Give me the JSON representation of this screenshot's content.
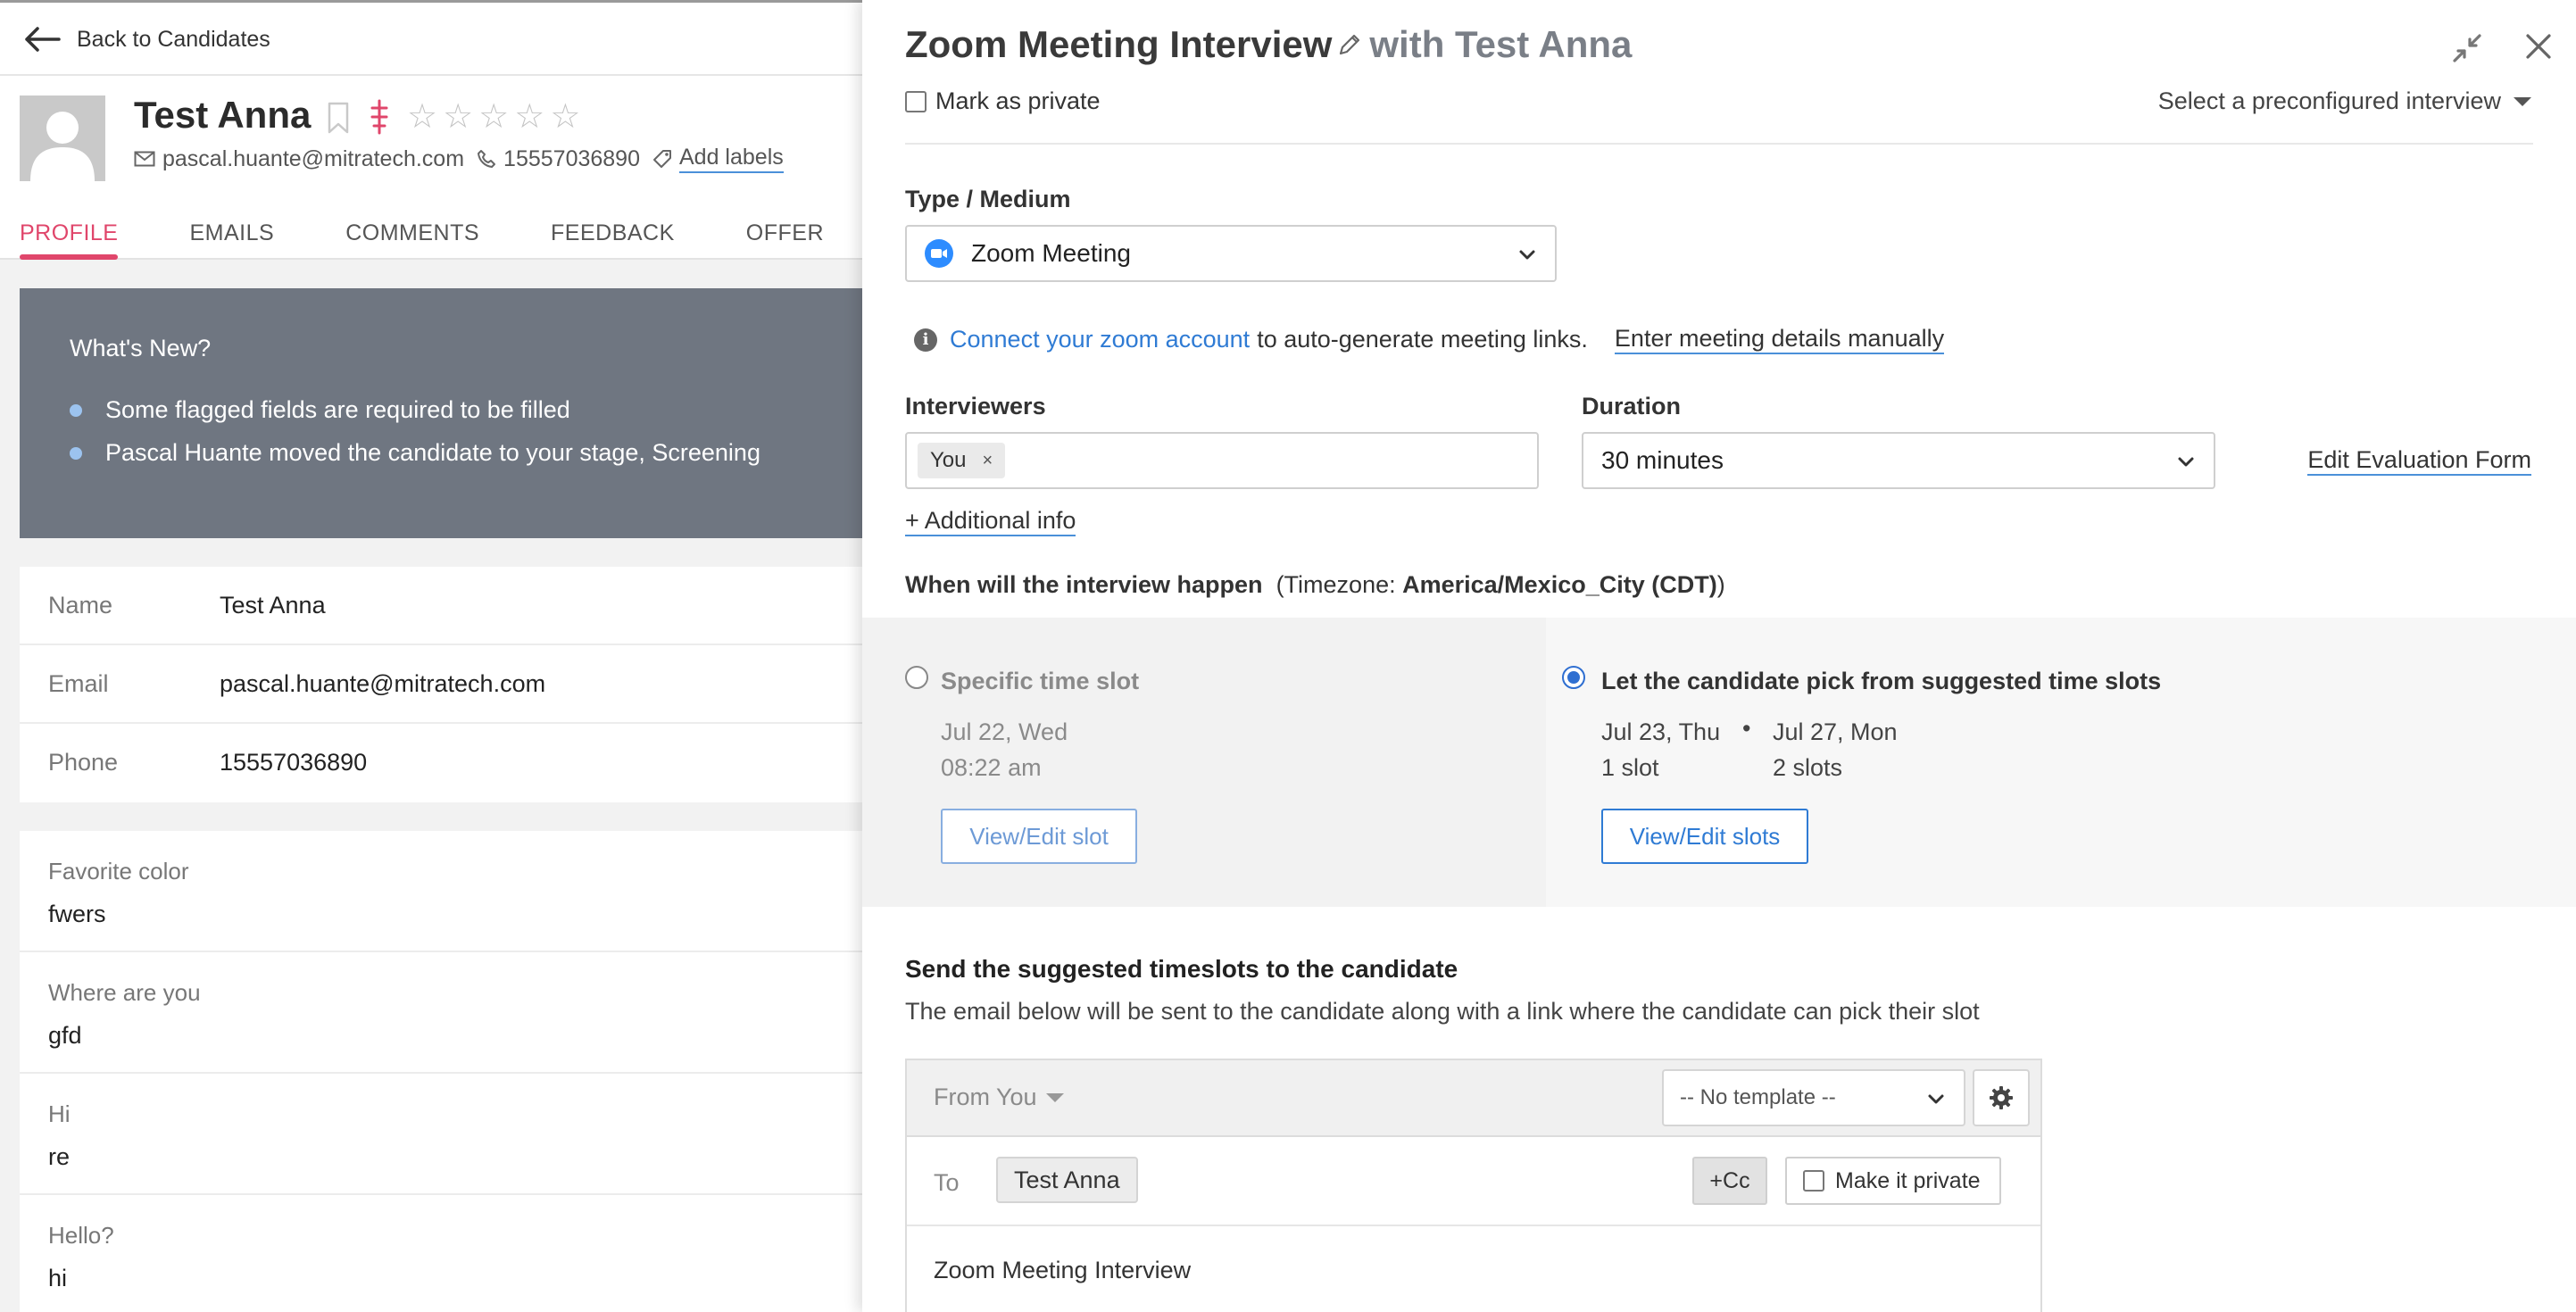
{
  "left": {
    "back_label": "Back to Candidates",
    "candidate": {
      "name": "Test Anna",
      "email": "pascal.huante@mitratech.com",
      "phone": "15557036890",
      "add_labels": "Add labels",
      "star_glyph": "☆"
    },
    "tabs": [
      "PROFILE",
      "EMAILS",
      "COMMENTS",
      "FEEDBACK",
      "OFFER"
    ],
    "active_tab": "PROFILE",
    "whats_new": {
      "title": "What's New?",
      "items": [
        "Some flagged fields are required to be filled",
        "Pascal Huante moved the candidate to your stage, Screening"
      ]
    },
    "info": [
      {
        "key": "Name",
        "value": "Test Anna"
      },
      {
        "key": "Email",
        "value": "pascal.huante@mitratech.com"
      },
      {
        "key": "Phone",
        "value": "15557036890"
      }
    ],
    "custom_fields": [
      {
        "key": "Favorite color",
        "value": "fwers"
      },
      {
        "key": "Where are you",
        "value": "gfd"
      },
      {
        "key": "Hi",
        "value": "re"
      },
      {
        "key": "Hello?",
        "value": "hi"
      }
    ]
  },
  "modal": {
    "title": "Zoom Meeting Interview",
    "title_with": "with Test Anna",
    "mark_private": "Mark as private",
    "preconfigured": "Select a preconfigured interview",
    "type_label": "Type / Medium",
    "type_value": "Zoom Meeting",
    "connect_link": "Connect your zoom account",
    "connect_rest": "to auto-generate meeting links.",
    "enter_manually": "Enter meeting details manually",
    "interviewers_label": "Interviewers",
    "interviewer_chip": "You",
    "chip_remove": "×",
    "duration_label": "Duration",
    "duration_value": "30 minutes",
    "edit_eval": "Edit Evaluation Form",
    "additional_info": "+ Additional info",
    "when_label": "When will the interview happen",
    "tz_prefix": "(Timezone: ",
    "tz_value": "America/Mexico_City (CDT)",
    "tz_suffix": ")",
    "specific": {
      "title": "Specific time slot",
      "date": "Jul 22, Wed",
      "time": "08:22 am",
      "button": "View/Edit slot"
    },
    "suggested": {
      "title": "Let the candidate pick from suggested time slots",
      "slots": [
        {
          "date": "Jul 23, Thu",
          "count": "1 slot"
        },
        {
          "date": "Jul 27, Mon",
          "count": "2 slots"
        }
      ],
      "separator": "•",
      "button": "View/Edit slots"
    },
    "send_title": "Send the suggested timeslots to the candidate",
    "send_desc": "The email below will be sent to the candidate along with a link where the candidate can pick their slot",
    "email": {
      "from": "From You",
      "template": "-- No template --",
      "to_label": "To",
      "to_chip": "Test Anna",
      "cc": "+Cc",
      "make_private": "Make it private",
      "subject": "Zoom Meeting Interview"
    }
  },
  "colors": {
    "accent_pink": "#e0466b",
    "link_blue": "#2f7bd4",
    "whats_new_bg": "#6f7681",
    "radio_selected": "#2f6fd1"
  },
  "icons": [
    "back-arrow-icon",
    "bookmark-icon",
    "flag-icon",
    "star-icon",
    "mail-icon",
    "phone-icon",
    "tag-icon",
    "pencil-icon",
    "compress-icon",
    "close-icon",
    "zoom-icon",
    "chevron-down-icon",
    "info-icon",
    "gear-icon"
  ]
}
